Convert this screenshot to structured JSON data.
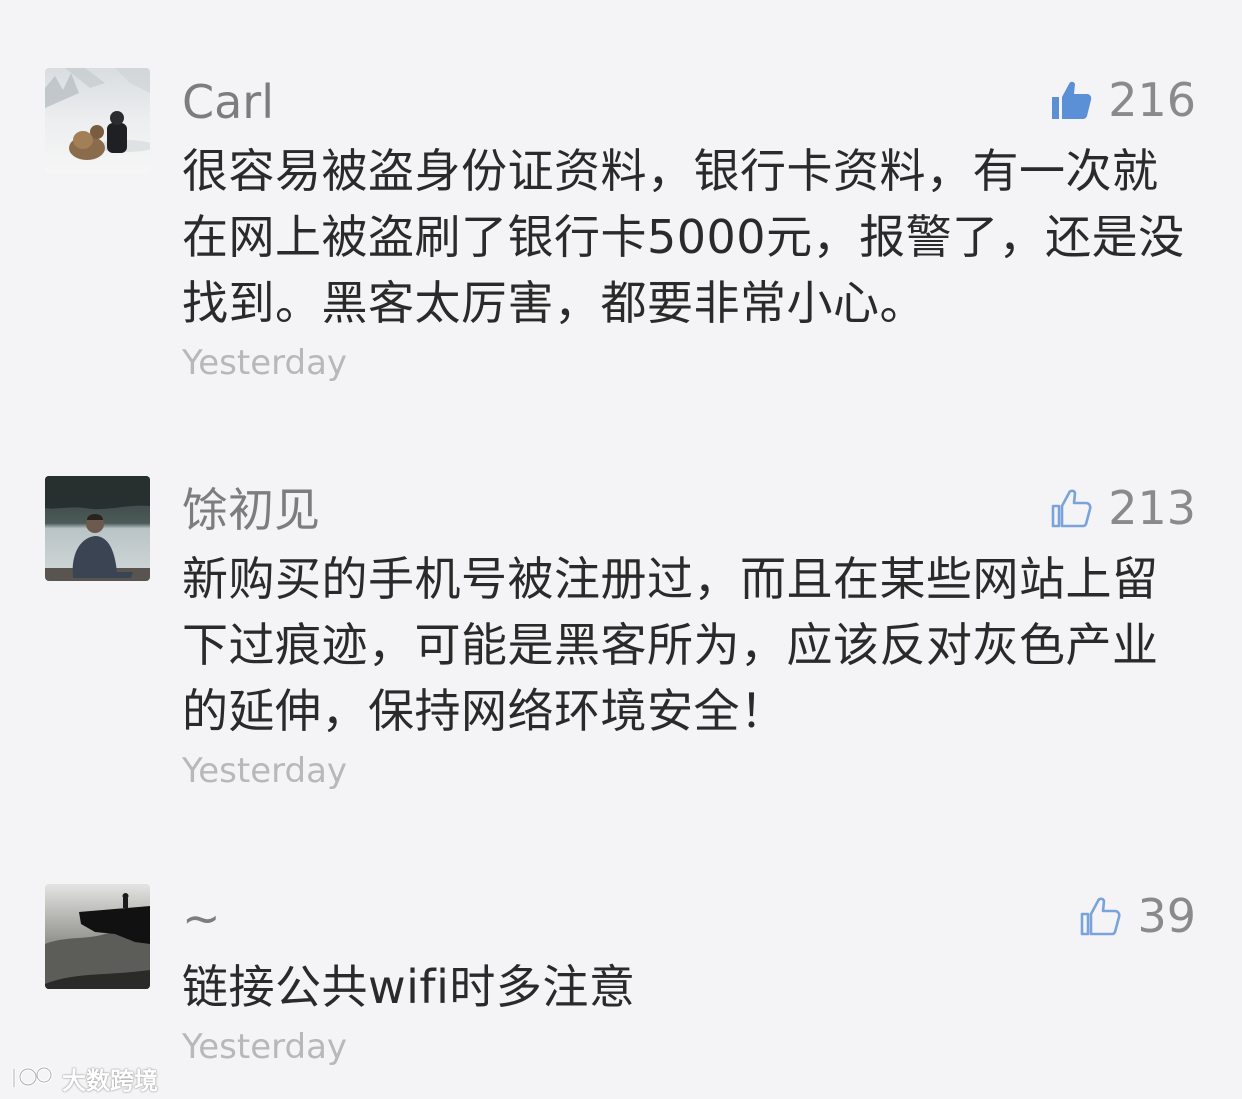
{
  "comments": [
    {
      "author": "Carl",
      "likes": "216",
      "liked": true,
      "text": "很容易被盗身份证资料，银行卡资料，有一次就在网上被盗刷了银行卡5000元，报警了，还是没找到。黑客太厉害，都要非常小心。",
      "time": "Yesterday",
      "avatar": "avatar-snow-dog-person"
    },
    {
      "author": "馀初见",
      "likes": "213",
      "liked": false,
      "text": "新购买的手机号被注册过，而且在某些网站上留下过痕迹，可能是黑客所为，应该反对灰色产业的延伸，保持网络环境安全！",
      "time": "Yesterday",
      "avatar": "avatar-man-by-lake"
    },
    {
      "author": "~",
      "likes": "39",
      "liked": false,
      "text": "链接公共wifi时多注意",
      "time": "Yesterday",
      "avatar": "avatar-rock-silhouette"
    }
  ],
  "watermark": {
    "icon": "logo-icon",
    "text": "大数跨境"
  },
  "colors": {
    "background": "#f4f4f6",
    "liked_thumb": "#5b8fd6",
    "unliked_thumb": "#7aa3dc",
    "author": "#7d7d7d",
    "text": "#2a2a2a",
    "time": "#b8b8b8"
  }
}
